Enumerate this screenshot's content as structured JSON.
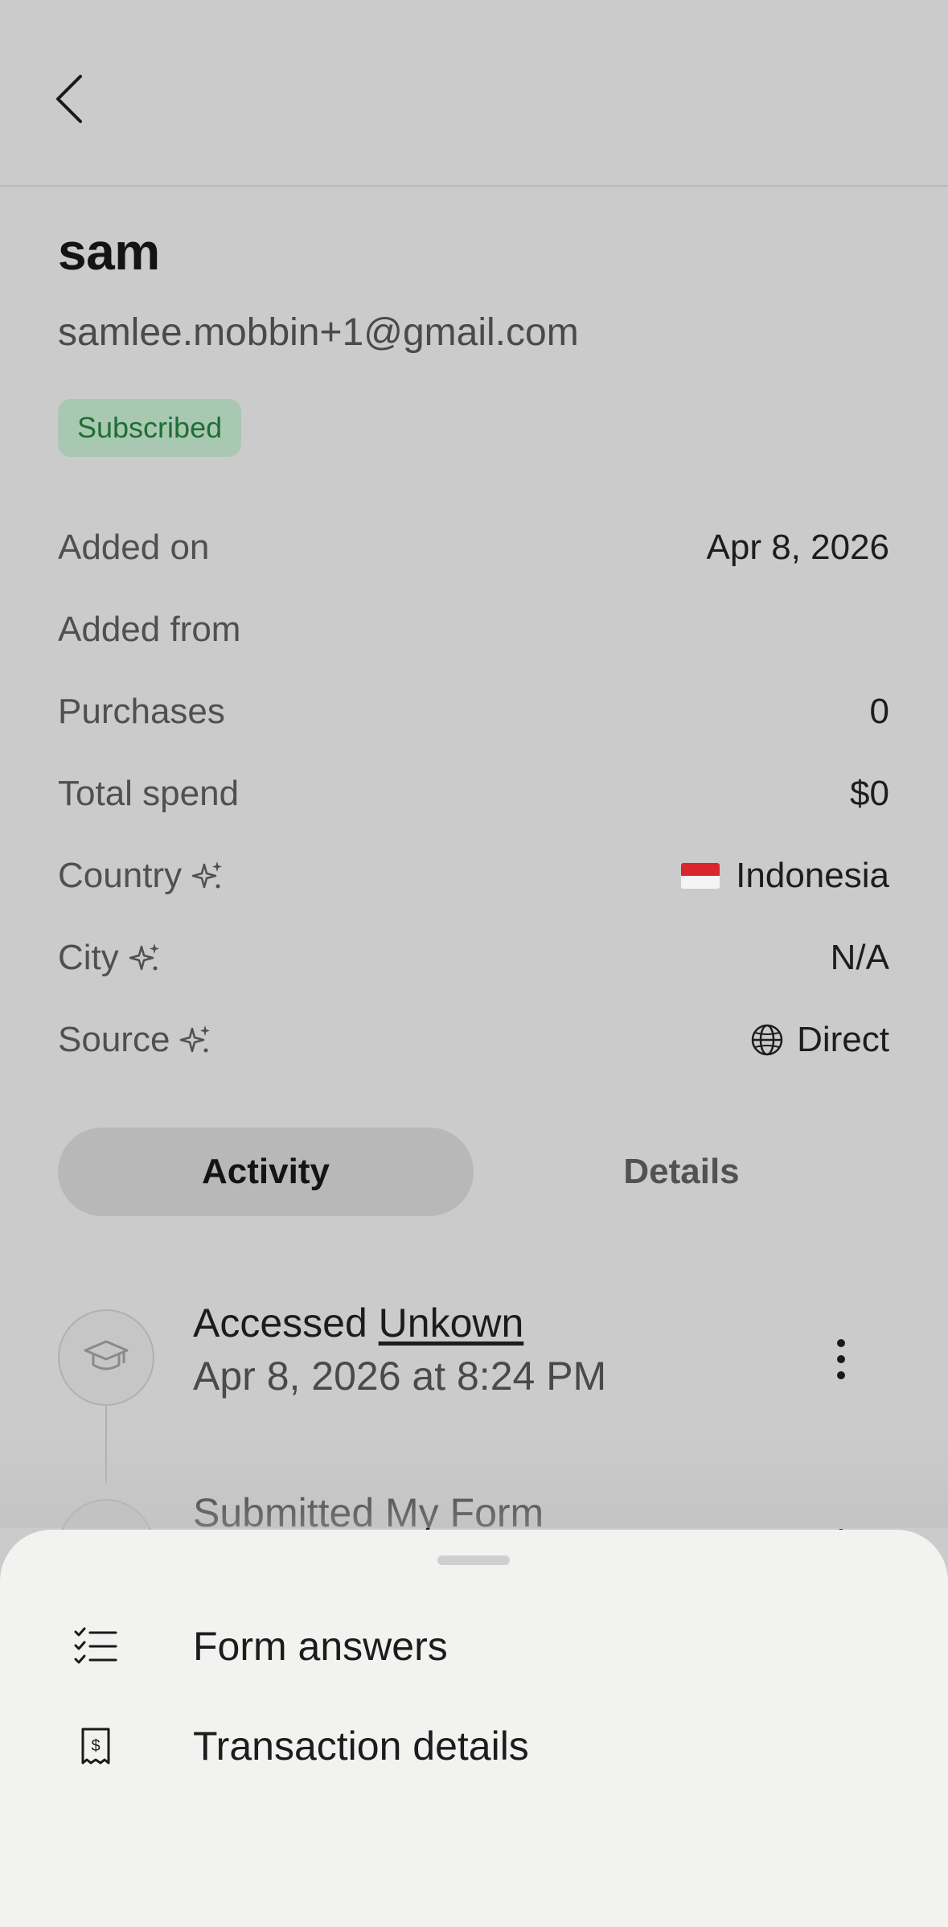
{
  "header": {
    "back_icon": "chevron-left-icon"
  },
  "profile": {
    "name": "sam",
    "email": "samlee.mobbin+1@gmail.com",
    "status_badge": "Subscribed",
    "badge_color": "#1f6e35"
  },
  "info": {
    "added_on_label": "Added on",
    "added_on_value": "Apr 8, 2026",
    "added_from_label": "Added from",
    "added_from_value": "",
    "purchases_label": "Purchases",
    "purchases_value": "0",
    "total_spend_label": "Total spend",
    "total_spend_value": "$0",
    "country_label": "Country",
    "country_value": "Indonesia",
    "city_label": "City",
    "city_value": "N/A",
    "source_label": "Source",
    "source_value": "Direct"
  },
  "tabs": [
    {
      "label": "Activity",
      "active": true
    },
    {
      "label": "Details",
      "active": false
    }
  ],
  "activity": [
    {
      "title_prefix": "Accessed ",
      "title_link": "Unkown",
      "time": "Apr 8, 2026 at 8:24 PM",
      "icon": "graduation-cap-icon"
    },
    {
      "title_prefix": "Submitted My Form",
      "title_link": "",
      "time": "",
      "icon": "form-icon"
    }
  ],
  "sheet": {
    "items": [
      {
        "label": "Form answers",
        "icon": "checklist-icon"
      },
      {
        "label": "Transaction details",
        "icon": "receipt-icon"
      }
    ]
  }
}
